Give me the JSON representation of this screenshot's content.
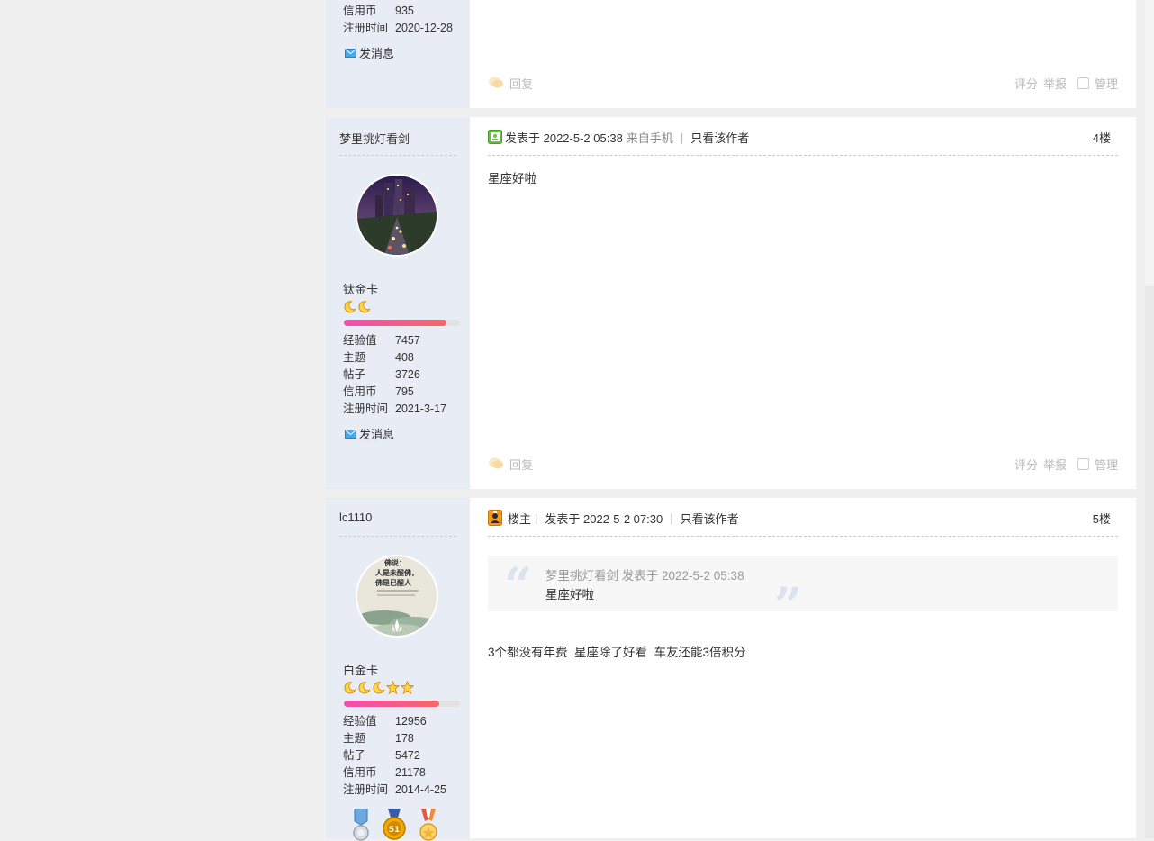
{
  "post_top": {
    "stats": [
      {
        "label": "信用币",
        "value": "935"
      },
      {
        "label": "注册时间",
        "value": "2020-12-28"
      }
    ],
    "send_message": "发消息",
    "reply": "回复",
    "rate": "评分",
    "report": "举报",
    "manage": "管理"
  },
  "post_4": {
    "author": "梦里挑灯看剑",
    "group": "钛金卡",
    "level_icons": [
      "moon",
      "moon"
    ],
    "progress_percent": 88,
    "stats": [
      {
        "label": "经验值",
        "value": "7457"
      },
      {
        "label": "主题",
        "value": "408"
      },
      {
        "label": "帖子",
        "value": "3726"
      },
      {
        "label": "信用币",
        "value": "795"
      },
      {
        "label": "注册时间",
        "value": "2021-3-17"
      }
    ],
    "send_message": "发消息",
    "posted_at": "发表于 2022-5-2 05:38",
    "source": "来自手机",
    "only_author": "只看该作者",
    "floor": "4楼",
    "body": "星座好啦",
    "reply": "回复",
    "rate": "评分",
    "report": "举报",
    "manage": "管理"
  },
  "post_5": {
    "author": "lc1110",
    "group": "白金卡",
    "level_icons": [
      "moon",
      "moon",
      "moon",
      "star",
      "star"
    ],
    "progress_percent": 82,
    "stats": [
      {
        "label": "经验值",
        "value": "12956"
      },
      {
        "label": "主题",
        "value": "178"
      },
      {
        "label": "帖子",
        "value": "5472"
      },
      {
        "label": "信用币",
        "value": "21178"
      },
      {
        "label": "注册时间",
        "value": "2014-4-25"
      }
    ],
    "owner_label": "楼主",
    "posted_at": "发表于 2022-5-2 07:30",
    "only_author": "只看该作者",
    "floor": "5楼",
    "quote": {
      "author_line": "梦里挑灯看剑 发表于 2022-5-2 05:38",
      "text": "星座好啦"
    },
    "body": "3个都没有年费  星座除了好看  车友还能3倍积分",
    "avatar_text_1": "佛说：",
    "avatar_text_2": "人是未醒佛，",
    "avatar_text_3": "佛是已醒人",
    "medal_label": "51"
  },
  "colors": {
    "author_bg": "#e8edf5",
    "progress_start": "#ef4fb0",
    "progress_end": "#f16a6a",
    "quote_bg": "#f7f7f7"
  }
}
